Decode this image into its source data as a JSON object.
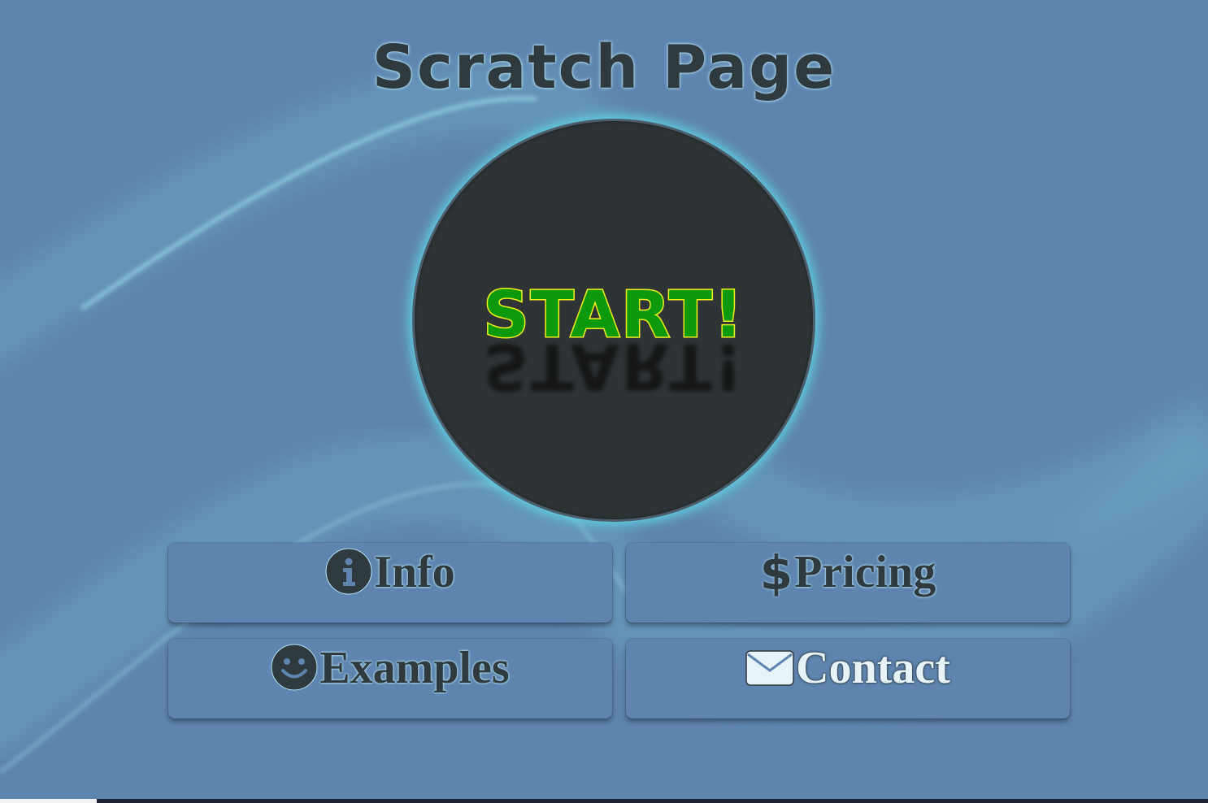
{
  "page": {
    "title": "Scratch Page"
  },
  "start_button": {
    "label": "START!",
    "reflection": "START!"
  },
  "nav": {
    "info": {
      "label": "Info",
      "icon": "info-circle-icon"
    },
    "pricing": {
      "label": "Pricing",
      "icon": "dollar-icon",
      "icon_glyph": "$"
    },
    "examples": {
      "label": "Examples",
      "icon": "smiley-icon"
    },
    "contact": {
      "label": "Contact",
      "icon": "envelope-icon"
    }
  },
  "colors": {
    "background": "#5e84af",
    "title_text": "#2e3a3d",
    "circle_fill": "#2e3436",
    "circle_glow": "#5fd3e3",
    "start_fill": "#0c9a0c",
    "start_outline": "#f2ef1b",
    "contact_text": "#e6f3f7"
  }
}
